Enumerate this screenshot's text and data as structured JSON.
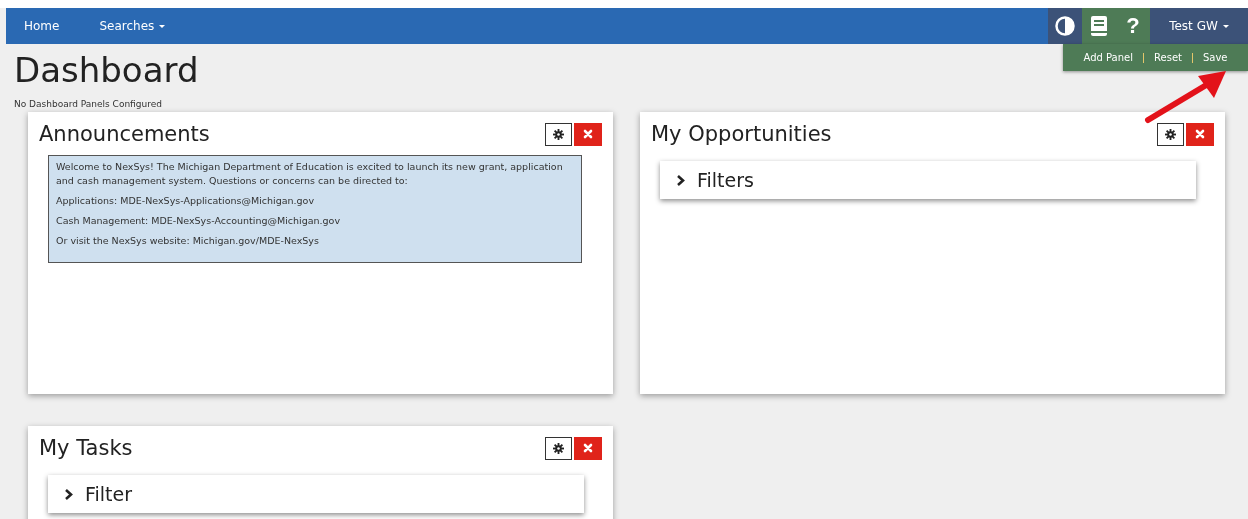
{
  "nav": {
    "items": [
      {
        "label": "Home",
        "has_caret": false
      },
      {
        "label": "Searches",
        "has_caret": true
      }
    ],
    "tools": [
      {
        "kind": "contrast",
        "highlighted": false
      },
      {
        "kind": "book",
        "highlighted": true
      },
      {
        "kind": "help",
        "label": "?",
        "highlighted": true
      }
    ],
    "user": {
      "label": "Test GW",
      "has_caret": true
    }
  },
  "panel_menu": [
    "Add Panel",
    "Reset",
    "Save"
  ],
  "page_title": "Dashboard",
  "empty_message": "No Dashboard Panels Configured",
  "panels": [
    {
      "title": "Announcements",
      "kind": "announcement",
      "paragraphs": [
        "Welcome to NexSys!  The Michigan Department of Education is excited to launch its new grant, application and cash management system.  Questions or concerns can be directed to:",
        "Applications:  MDE-NexSys-Applications@Michigan.gov",
        "Cash Management:  MDE-NexSys-Accounting@Michigan.gov",
        "Or visit the NexSys website:  Michigan.gov/MDE-NexSys"
      ]
    },
    {
      "title": "My Opportunities",
      "kind": "filter",
      "filter_label": "Filters"
    },
    {
      "title": "My Tasks",
      "kind": "filter",
      "filter_label": "Filter"
    }
  ]
}
